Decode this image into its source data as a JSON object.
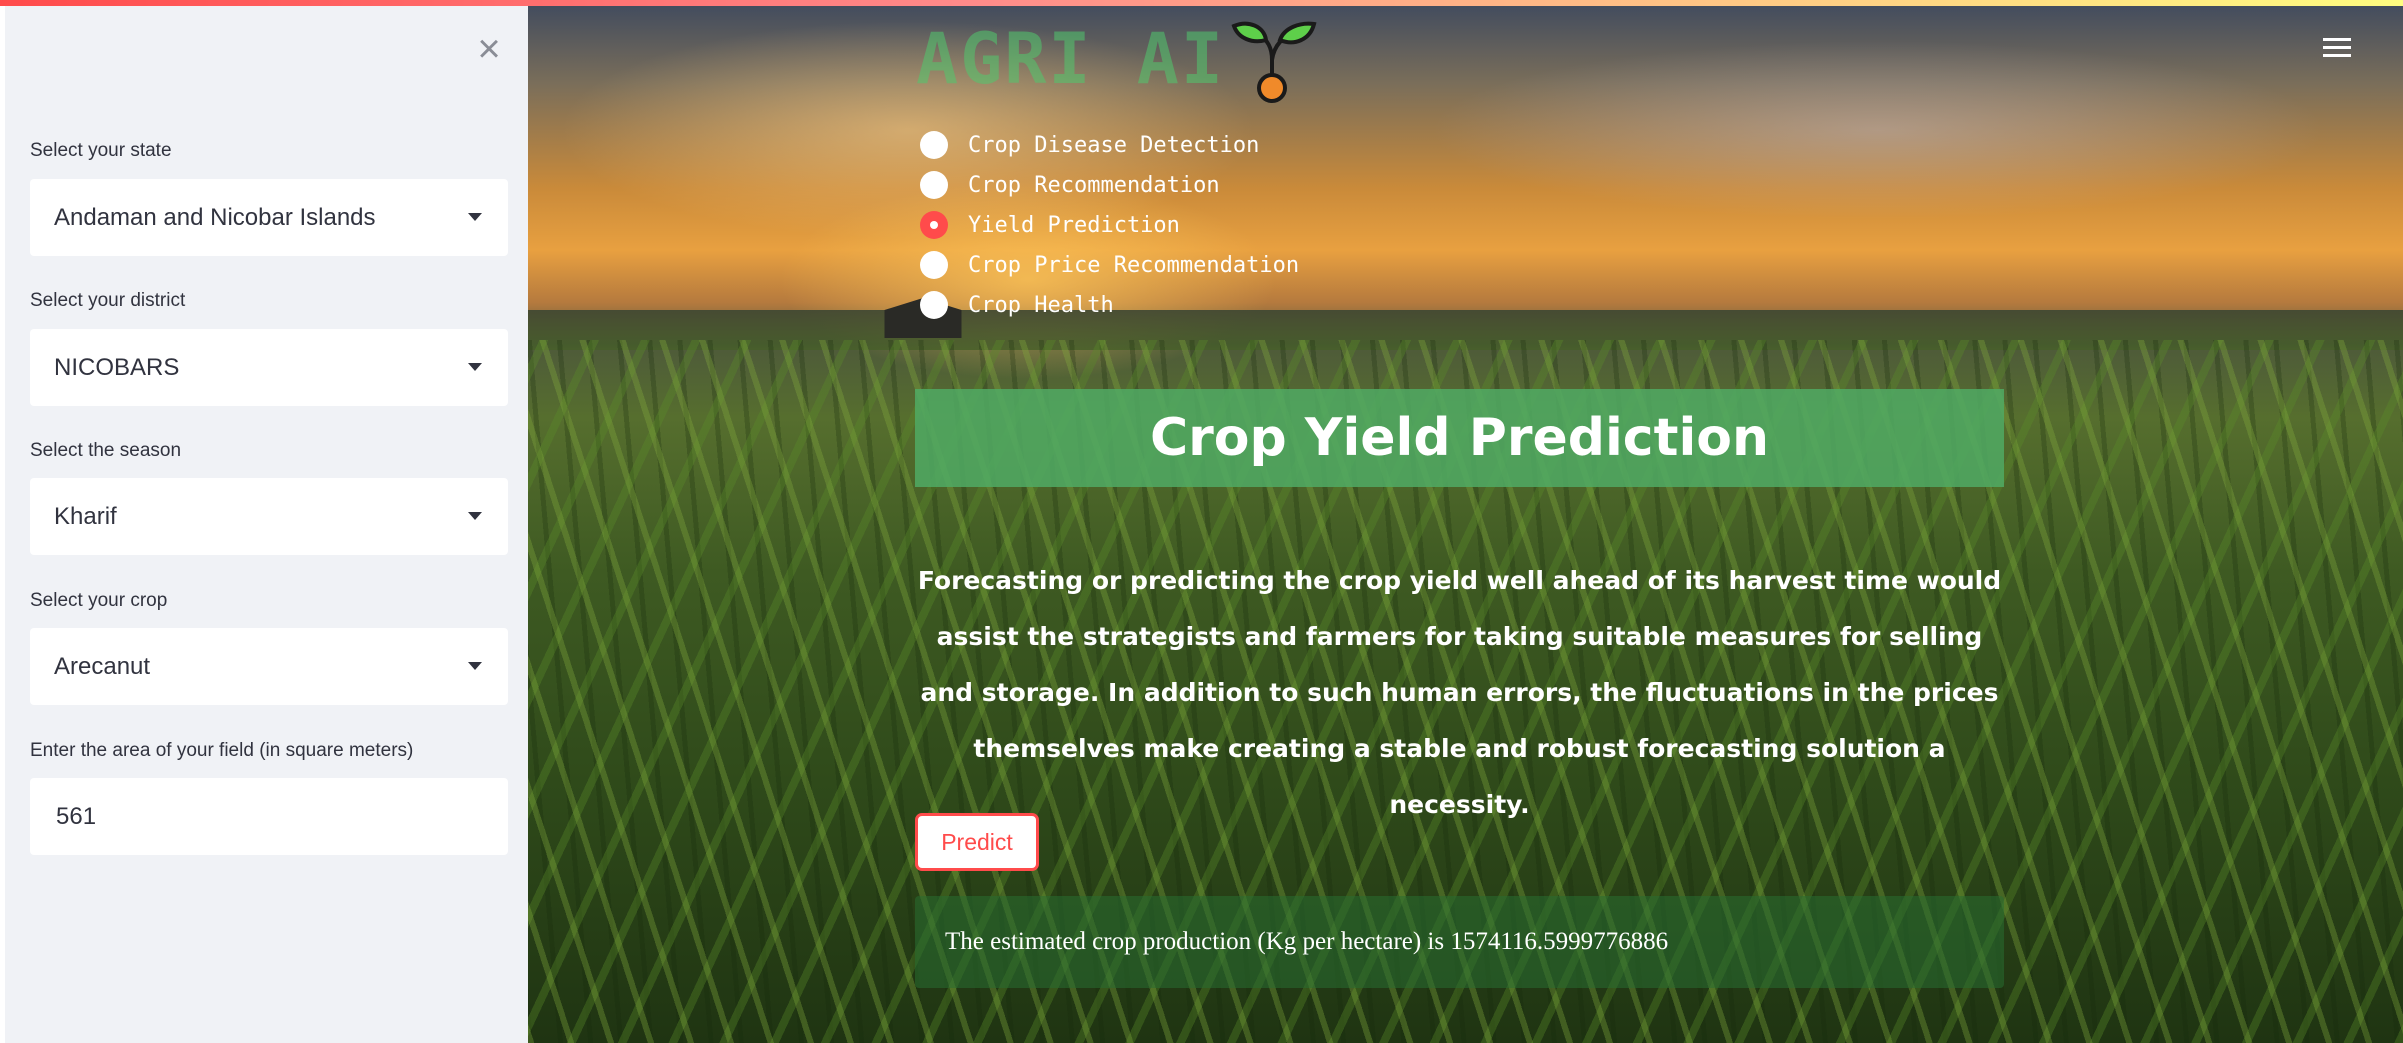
{
  "sidebar": {
    "state_label": "Select your state",
    "state_value": "Andaman and Nicobar Islands",
    "district_label": "Select your district",
    "district_value": "NICOBARS",
    "season_label": "Select the season",
    "season_value": "Kharif",
    "crop_label": "Select your crop",
    "crop_value": "Arecanut",
    "area_label": "Enter the area of your field (in square meters)",
    "area_value": "561",
    "close_glyph": "×"
  },
  "header": {
    "brand": "AGRI AI"
  },
  "nav": {
    "options": [
      "Crop Disease Detection",
      "Crop Recommendation",
      "Yield Prediction",
      "Crop Price Recommendation",
      "Crop Health"
    ],
    "selected": "Yield Prediction"
  },
  "main": {
    "title": "Crop Yield Prediction",
    "description": "Forecasting or predicting the crop yield well ahead of its harvest time would assist the strategists and farmers for taking suitable measures for selling and storage. In addition to such human errors, the fluctuations in the prices themselves make creating a stable and robust forecasting solution a necessity.",
    "predict_label": "Predict",
    "result_text": "The estimated crop production (Kg per hectare) is 1574116.5999776886"
  },
  "colors": {
    "accent": "#ff4b4b",
    "title_bar": "#50aa64",
    "sidebar_bg": "#f0f2f6"
  },
  "icons": {
    "close": "close-icon",
    "menu": "hamburger-menu-icon",
    "logo": "sprout-icon",
    "select_caret": "caret-down-icon"
  }
}
